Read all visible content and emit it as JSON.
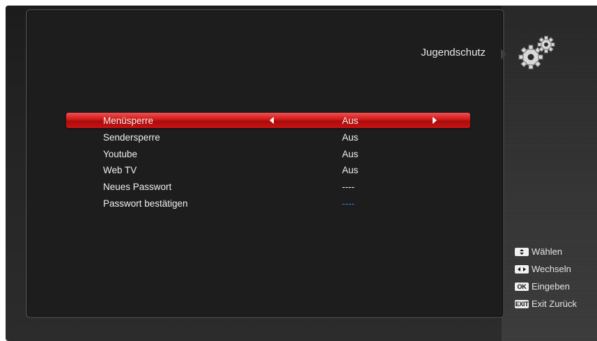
{
  "screen_title": "Jugendschutz",
  "gear_icon": "gear-icon",
  "menu": {
    "items": [
      {
        "label": "Menüsperre",
        "value": "Aus",
        "selected": true
      },
      {
        "label": "Sendersperre",
        "value": "Aus",
        "selected": false
      },
      {
        "label": "Youtube",
        "value": "Aus",
        "selected": false
      },
      {
        "label": "Web TV",
        "value": "Aus",
        "selected": false
      },
      {
        "label": "Neues Passwort",
        "value": "----",
        "selected": false
      },
      {
        "label": "Passwort bestätigen",
        "value": "----",
        "selected": false
      }
    ]
  },
  "hints": [
    {
      "key": "",
      "icon": "up-down-key-icon",
      "label": "Wählen"
    },
    {
      "key": "",
      "icon": "left-right-key-icon",
      "label": "Wechseln"
    },
    {
      "key": "OK",
      "icon": "ok-key-icon",
      "label": "Eingeben"
    },
    {
      "key": "EXIT",
      "icon": "exit-key-icon",
      "label": "Exit Zurück"
    }
  ],
  "colors": {
    "selection_red": "#d01818",
    "confirm_password_value": "#2f7fe0",
    "text": "#efefef"
  }
}
